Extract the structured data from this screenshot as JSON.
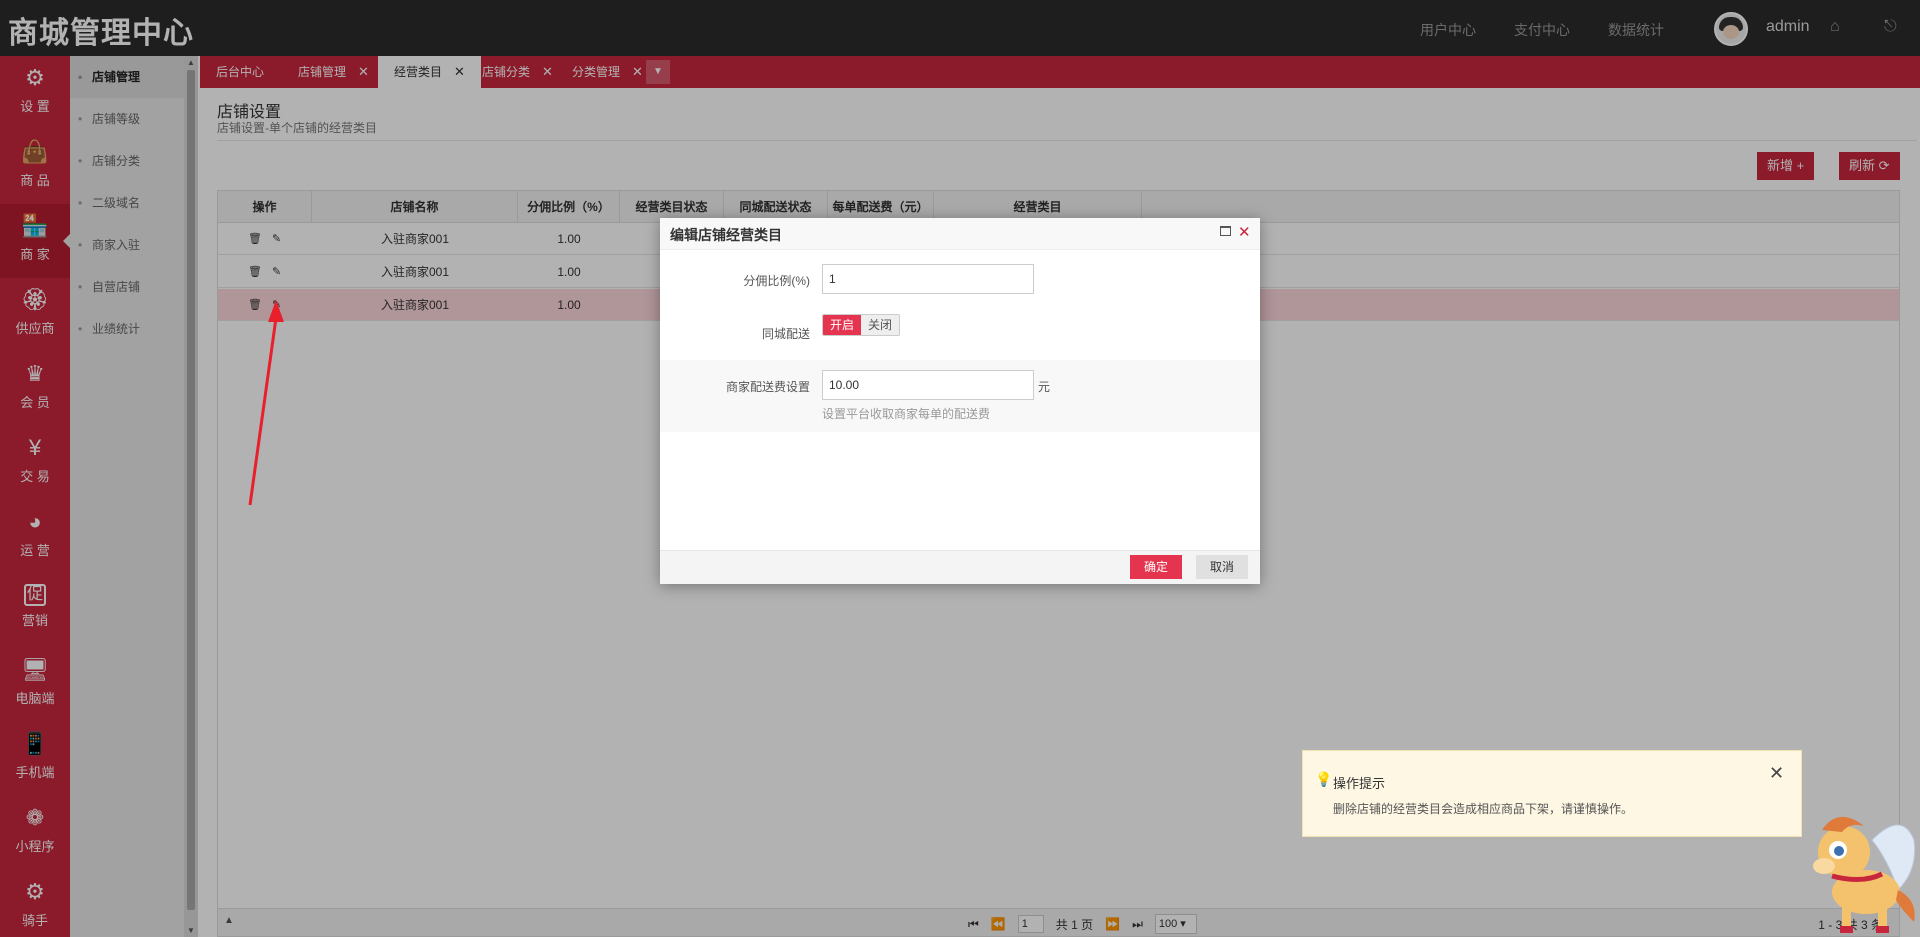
{
  "header": {
    "logo": "商城管理中心",
    "nav": [
      "用户中心",
      "支付中心",
      "数据统计"
    ],
    "user": "admin"
  },
  "sidebar": {
    "items": [
      {
        "label": "设 置",
        "icon": "gear-icon",
        "glyph": "⚙"
      },
      {
        "label": "商 品",
        "icon": "bag-icon",
        "glyph": "👜"
      },
      {
        "label": "商 家",
        "icon": "store-icon",
        "glyph": "🏪",
        "active": true
      },
      {
        "label": "供应商",
        "icon": "award-icon",
        "glyph": "🏵"
      },
      {
        "label": "会 员",
        "icon": "crown-icon",
        "glyph": "♛"
      },
      {
        "label": "交 易",
        "icon": "yen-icon",
        "glyph": "¥"
      },
      {
        "label": "运 营",
        "icon": "pie-chart-icon",
        "glyph": "◕"
      },
      {
        "label": "营销",
        "icon": "promo-icon",
        "glyph": "促"
      },
      {
        "label": "电脑端",
        "icon": "monitor-icon",
        "glyph": "🖥"
      },
      {
        "label": "手机端",
        "icon": "mobile-icon",
        "glyph": "📱"
      },
      {
        "label": "小程序",
        "icon": "miniapp-icon",
        "glyph": "❁"
      },
      {
        "label": "骑手",
        "icon": "gear-icon",
        "glyph": "⚙"
      }
    ]
  },
  "submenu": {
    "items": [
      "店铺管理",
      "店铺等级",
      "店铺分类",
      "二级域名",
      "商家入驻",
      "自营店铺",
      "业绩统计"
    ]
  },
  "tabs": [
    {
      "label": "后台中心",
      "closable": false
    },
    {
      "label": "店铺管理",
      "closable": true
    },
    {
      "label": "经营类目",
      "closable": true,
      "active": true
    },
    {
      "label": "店铺分类",
      "closable": true
    },
    {
      "label": "分类管理",
      "closable": true
    }
  ],
  "page": {
    "title": "店铺设置",
    "subtitle": "店铺设置-单个店铺的经营类目",
    "add_button": "新增 +",
    "refresh_button": "刷新 ⟳"
  },
  "table": {
    "headers": [
      "操作",
      "店铺名称",
      "分佣比例（%）",
      "经营类目状态",
      "同城配送状态",
      "每单配送费（元）",
      "经营类目"
    ],
    "rows": [
      {
        "name": "入驻商家001",
        "ratio": "1.00"
      },
      {
        "name": "入驻商家001",
        "ratio": "1.00"
      },
      {
        "name": "入驻商家001",
        "ratio": "1.00"
      }
    ],
    "pager": {
      "page_input": "1",
      "total_pages": "共 1 页",
      "page_size": "100",
      "count": "1 - 3 共 3 条"
    }
  },
  "dialog": {
    "title": "编辑店铺经营类目",
    "fields": {
      "ratio_label": "分佣比例(%)",
      "ratio_value": "1",
      "delivery_label": "同城配送",
      "delivery_on": "开启",
      "delivery_off": "关闭",
      "fee_label": "商家配送费设置",
      "fee_value": "10.00",
      "fee_unit": "元",
      "fee_hint": "设置平台收取商家每单的配送费"
    },
    "ok": "确定",
    "cancel": "取消"
  },
  "tip": {
    "title": "操作提示",
    "text": "删除店铺的经营类目会造成相应商品下架，请谨慎操作。"
  },
  "colors": {
    "brand_red": "#c8263d",
    "topbar": "#2b2b2b",
    "primary_button": "#e5344f"
  }
}
